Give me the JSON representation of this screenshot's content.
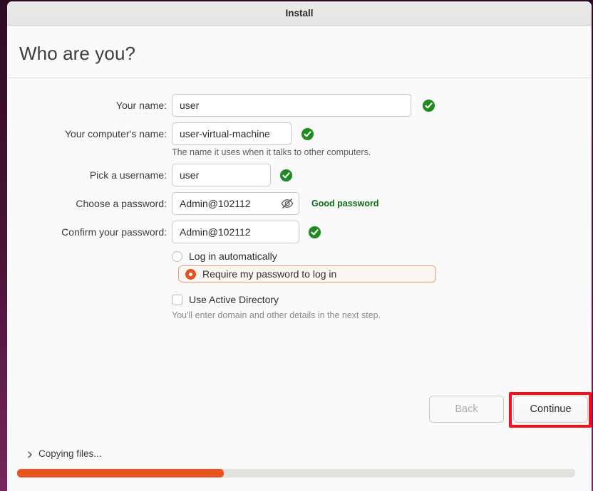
{
  "window": {
    "title": "Install"
  },
  "page": {
    "title": "Who are you?"
  },
  "form": {
    "fields": [
      {
        "label": "Your name:",
        "value": "user",
        "placeholder": "",
        "valid_icon": "check-circle-icon"
      },
      {
        "label": "Your computer's name:",
        "value": "user-virtual-machine",
        "placeholder": "",
        "valid_icon": "check-circle-icon",
        "hint": "The name it uses when it talks to other computers."
      },
      {
        "label": "Pick a username:",
        "value": "user",
        "placeholder": "",
        "valid_icon": "check-circle-icon"
      },
      {
        "label": "Choose a password:",
        "value": "Admin@102112",
        "placeholder": "",
        "reveal_icon": "eye-slash-icon",
        "strength": "Good password"
      },
      {
        "label": "Confirm your password:",
        "value": "Admin@102112",
        "placeholder": "",
        "valid_icon": "check-circle-icon"
      }
    ],
    "options": [
      {
        "type": "radio",
        "label": "Log in automatically",
        "checked": false,
        "focused": false
      },
      {
        "type": "radio",
        "label": "Require my password to log in",
        "checked": true,
        "focused": true
      },
      {
        "type": "checkbox",
        "label": "Use Active Directory",
        "checked": false,
        "focused": false
      }
    ],
    "active_directory_hint": "You'll enter domain and other details in the next step."
  },
  "footer": {
    "back_label": "Back",
    "back_disabled": true,
    "continue_label": "Continue",
    "continue_highlighted": true
  },
  "progress": {
    "status": "Copying files...",
    "expander_icon": "chevron-right-icon",
    "percent": 37
  },
  "colors": {
    "accent_orange": "#e95420",
    "window_border": "#4d1438",
    "valid_green": "#1f8a21",
    "strength_green": "#0c6b18",
    "annotation_red": "#fc0d1b",
    "focus_ring": "#f09b6f"
  }
}
